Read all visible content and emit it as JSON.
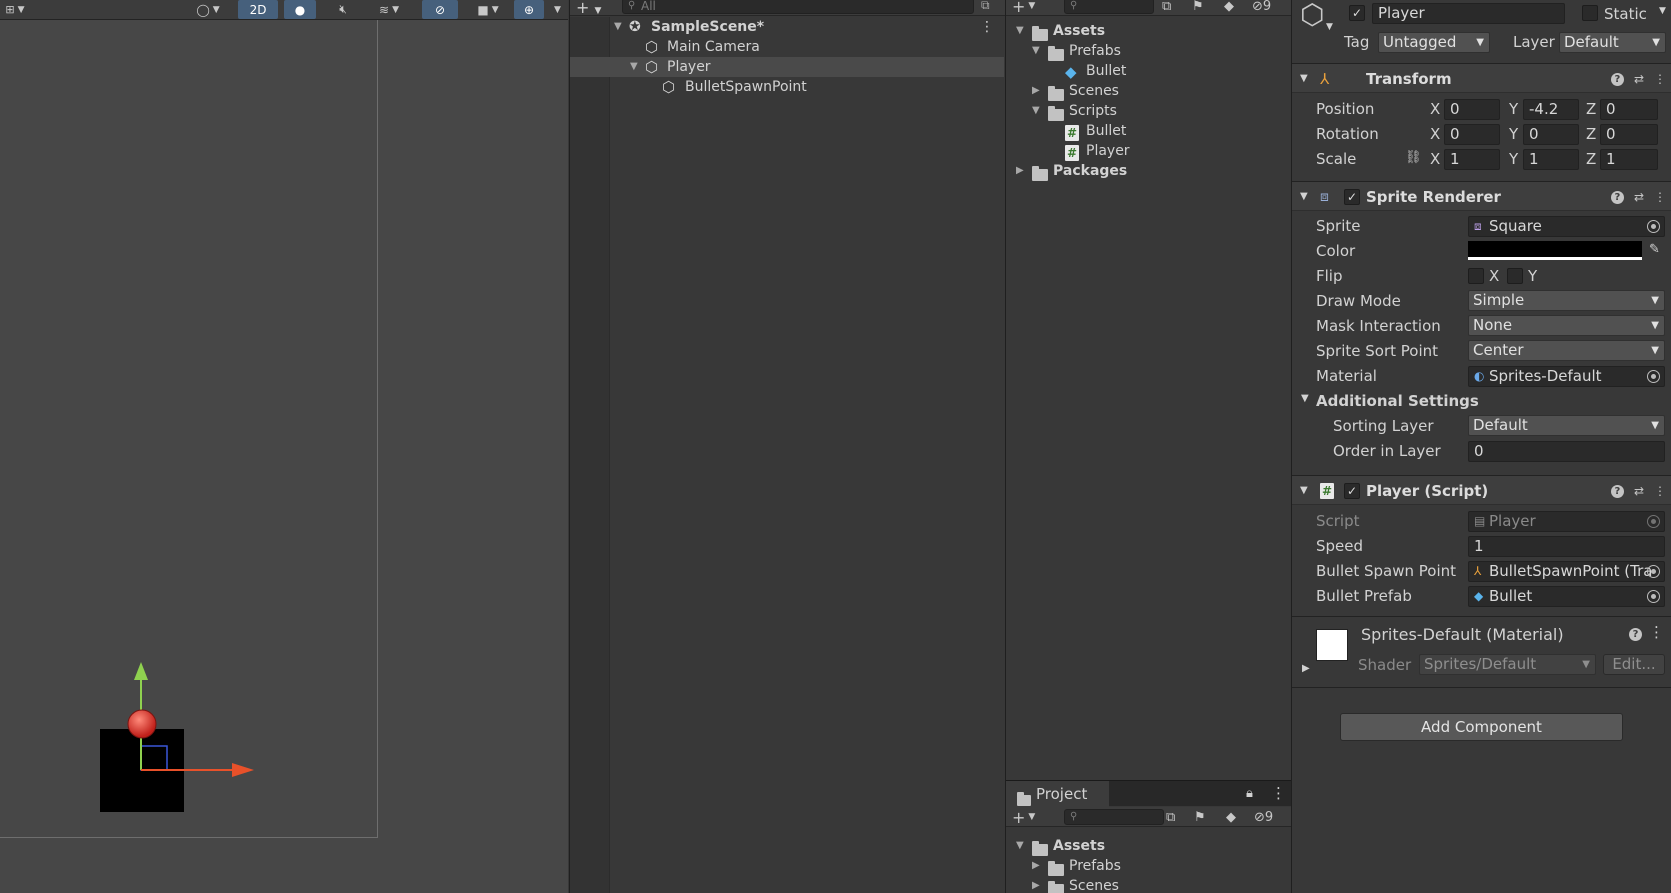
{
  "scene": {
    "toolbar": {
      "mode_2d": "2D"
    }
  },
  "hierarchy": {
    "search_placeholder": "All",
    "items": [
      {
        "label": "SampleScene*"
      },
      {
        "label": "Main Camera"
      },
      {
        "label": "Player"
      },
      {
        "label": "BulletSpawnPoint"
      }
    ]
  },
  "project_top": {
    "hidden_count": "9",
    "items": [
      {
        "label": "Assets"
      },
      {
        "label": "Prefabs"
      },
      {
        "label": "Bullet"
      },
      {
        "label": "Scenes"
      },
      {
        "label": "Scripts"
      },
      {
        "label": "Bullet"
      },
      {
        "label": "Player"
      },
      {
        "label": "Packages"
      }
    ]
  },
  "project_panel": {
    "tab_label": "Project",
    "hidden_count": "9",
    "items": [
      {
        "label": "Assets"
      },
      {
        "label": "Prefabs"
      },
      {
        "label": "Scenes"
      }
    ]
  },
  "inspector": {
    "object_name": "Player",
    "static_label": "Static",
    "tag_label": "Tag",
    "tag_value": "Untagged",
    "layer_label": "Layer",
    "layer_value": "Default",
    "transform": {
      "title": "Transform",
      "position_label": "Position",
      "rotation_label": "Rotation",
      "scale_label": "Scale",
      "position": {
        "x": "0",
        "y": "-4.2",
        "z": "0"
      },
      "rotation": {
        "x": "0",
        "y": "0",
        "z": "0"
      },
      "scale": {
        "x": "1",
        "y": "1",
        "z": "1"
      }
    },
    "axis": {
      "x": "X",
      "y": "Y",
      "z": "Z"
    },
    "sprite_renderer": {
      "title": "Sprite Renderer",
      "sprite_label": "Sprite",
      "sprite_value": "Square",
      "color_label": "Color",
      "color_value": "#000000",
      "flip_label": "Flip",
      "flip_x": "X",
      "flip_y": "Y",
      "draw_mode_label": "Draw Mode",
      "draw_mode_value": "Simple",
      "mask_label": "Mask Interaction",
      "mask_value": "None",
      "sort_point_label": "Sprite Sort Point",
      "sort_point_value": "Center",
      "material_label": "Material",
      "material_value": "Sprites-Default",
      "additional_label": "Additional Settings",
      "sorting_layer_label": "Sorting Layer",
      "sorting_layer_value": "Default",
      "order_label": "Order in Layer",
      "order_value": "0"
    },
    "player_script": {
      "title": "Player (Script)",
      "script_label": "Script",
      "script_value": "Player",
      "speed_label": "Speed",
      "speed_value": "1",
      "spawn_label": "Bullet Spawn Point",
      "spawn_value": "BulletSpawnPoint (Tra",
      "prefab_label": "Bullet Prefab",
      "prefab_value": "Bullet"
    },
    "material": {
      "title": "Sprites-Default (Material)",
      "shader_label": "Shader",
      "shader_value": "Sprites/Default",
      "edit_label": "Edit..."
    },
    "add_component_label": "Add Component"
  }
}
